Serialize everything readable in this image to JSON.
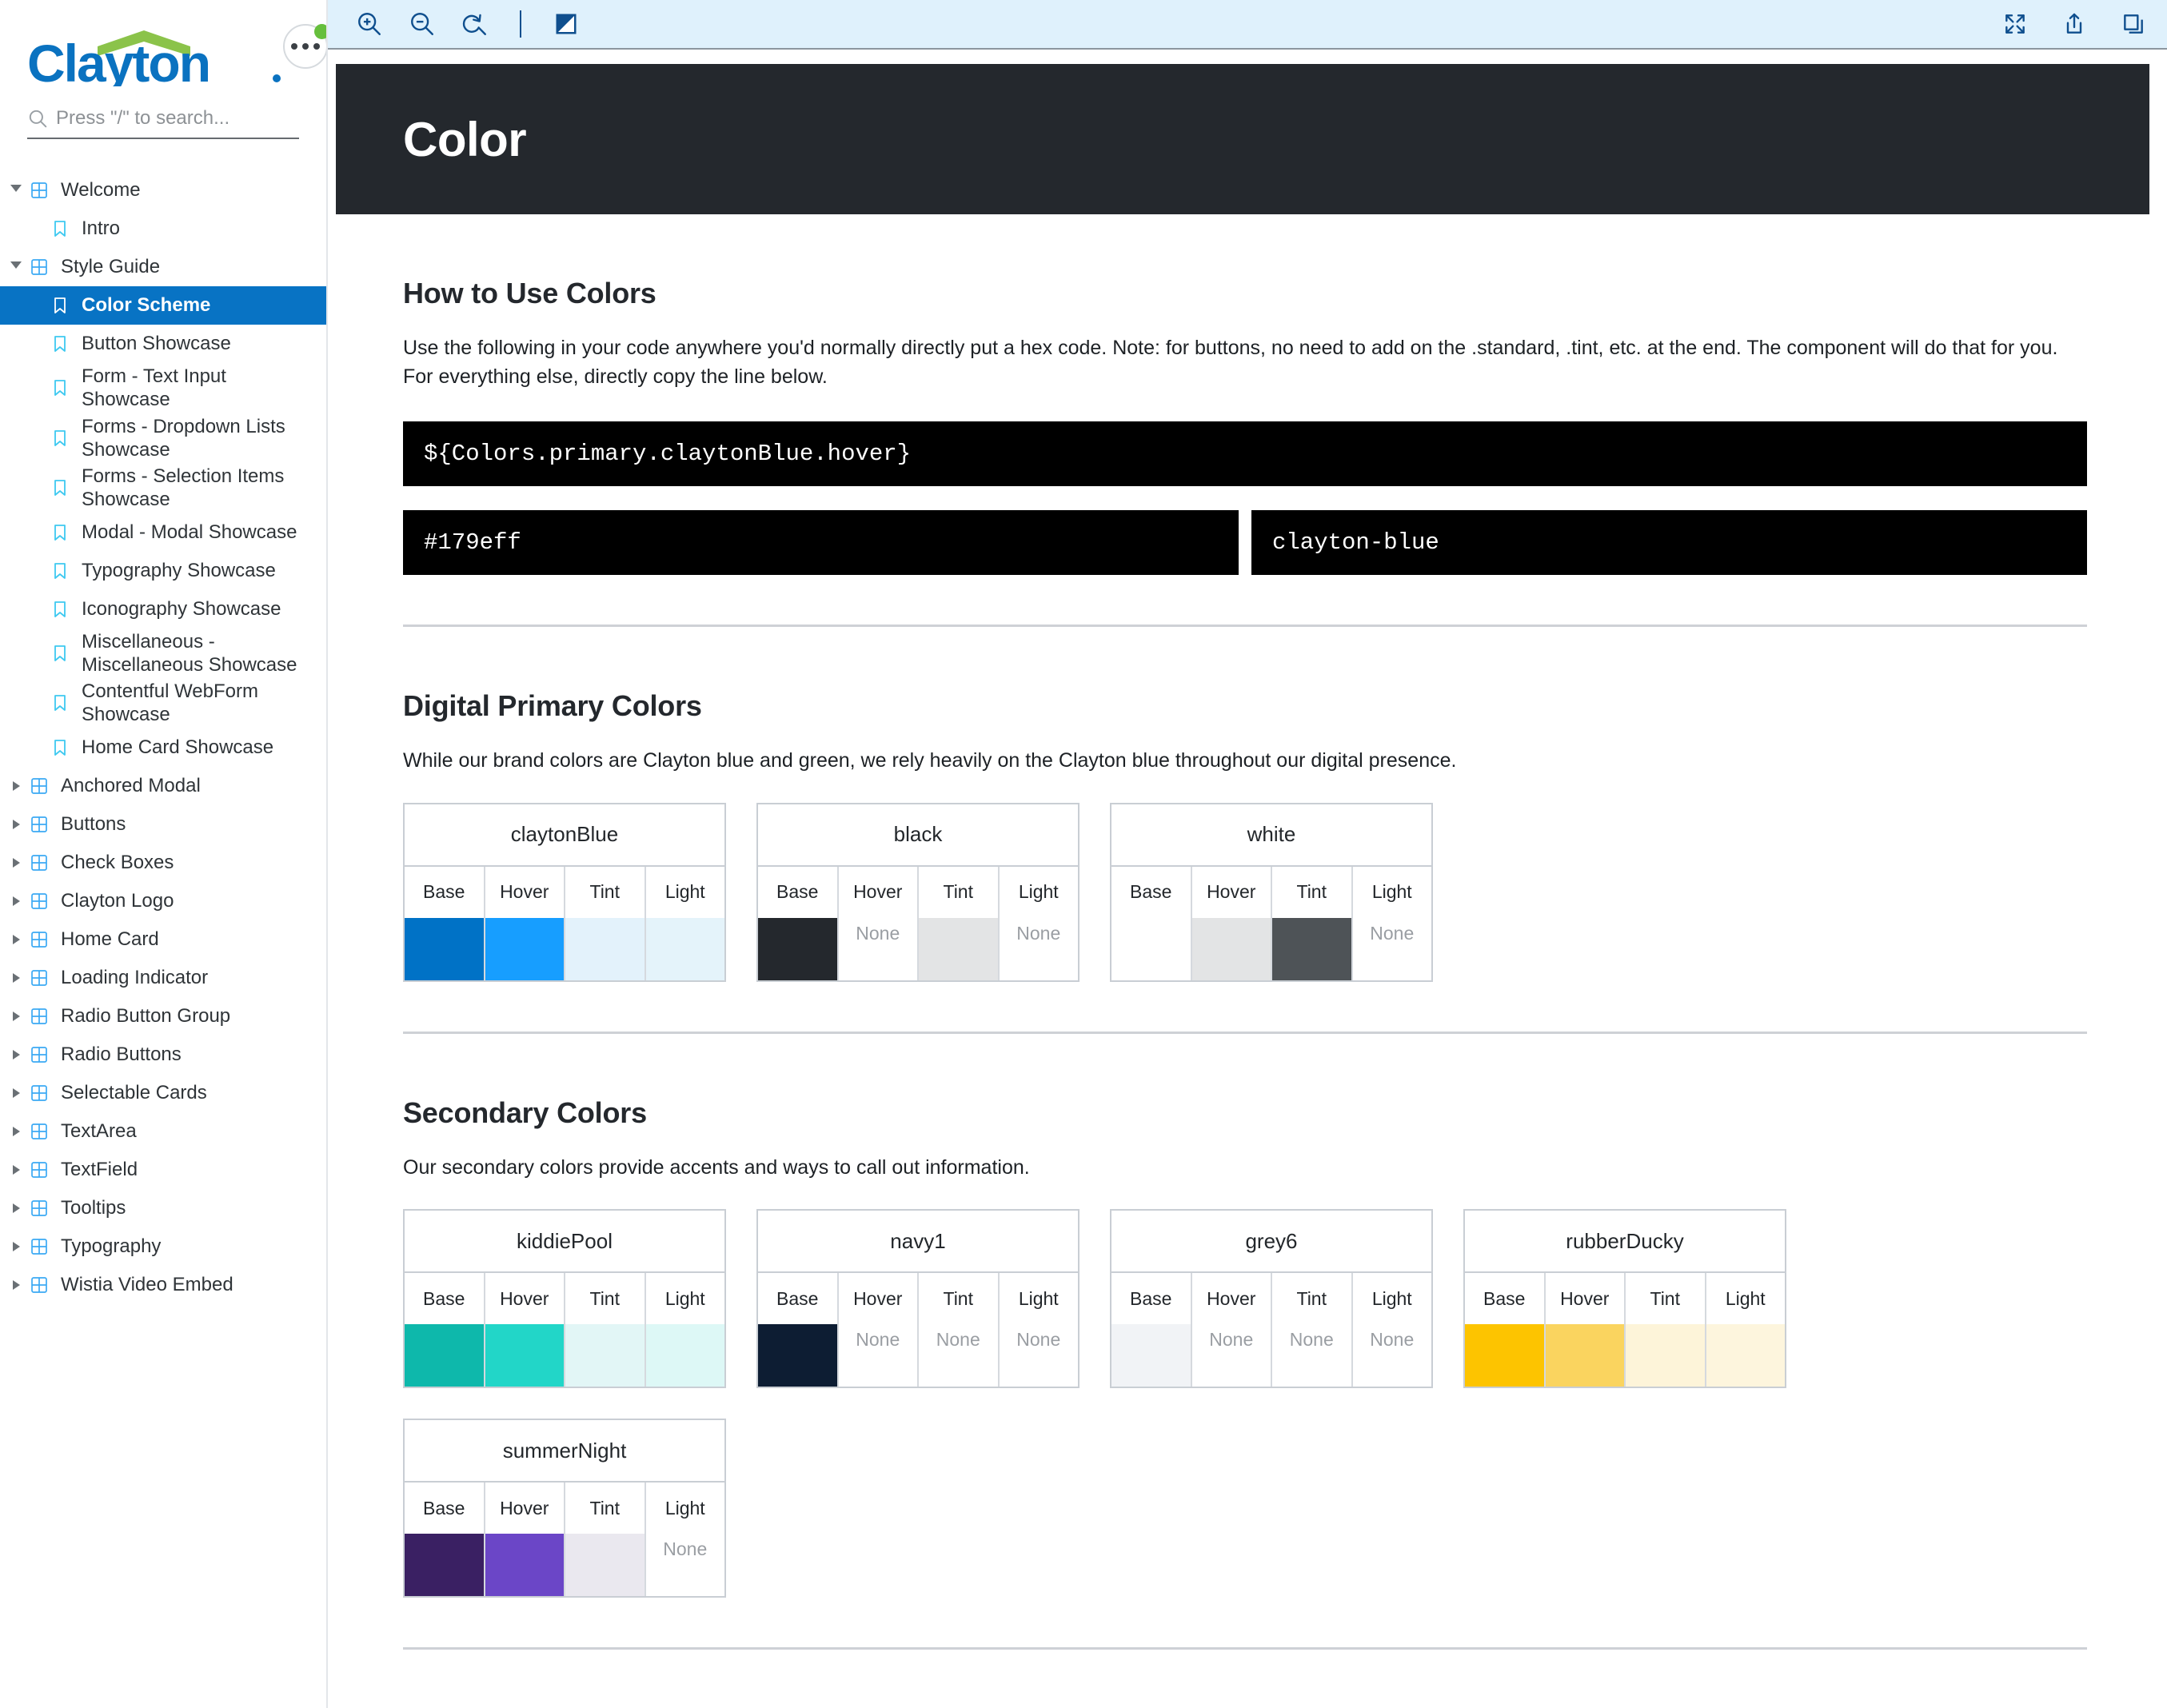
{
  "sidebar": {
    "brand": "Clayton",
    "search": {
      "placeholder": "Press \"/\" to search...",
      "value": ""
    },
    "items": [
      {
        "label": "Welcome",
        "level": "root",
        "icon": "component-icon",
        "caret": "open",
        "selected": false
      },
      {
        "label": "Intro",
        "level": "child",
        "icon": "bookmark-icon",
        "caret": "none",
        "selected": false
      },
      {
        "label": "Style Guide",
        "level": "root",
        "icon": "component-icon",
        "caret": "open",
        "selected": false
      },
      {
        "label": "Color Scheme",
        "level": "child",
        "icon": "bookmark-icon",
        "caret": "none",
        "selected": true
      },
      {
        "label": "Button Showcase",
        "level": "child",
        "icon": "bookmark-icon",
        "caret": "none",
        "selected": false
      },
      {
        "label": "Form - Text Input Showcase",
        "level": "child",
        "icon": "bookmark-icon",
        "caret": "none",
        "selected": false
      },
      {
        "label": "Forms - Dropdown Lists Showcase",
        "level": "child",
        "icon": "bookmark-icon",
        "caret": "none",
        "selected": false
      },
      {
        "label": "Forms - Selection Items Showcase",
        "level": "child",
        "icon": "bookmark-icon",
        "caret": "none",
        "selected": false
      },
      {
        "label": "Modal - Modal Showcase",
        "level": "child",
        "icon": "bookmark-icon",
        "caret": "none",
        "selected": false
      },
      {
        "label": "Typography Showcase",
        "level": "child",
        "icon": "bookmark-icon",
        "caret": "none",
        "selected": false
      },
      {
        "label": "Iconography Showcase",
        "level": "child",
        "icon": "bookmark-icon",
        "caret": "none",
        "selected": false
      },
      {
        "label": "Miscellaneous - Miscellaneous Showcase",
        "level": "child",
        "icon": "bookmark-icon",
        "caret": "none",
        "selected": false
      },
      {
        "label": "Contentful WebForm Showcase",
        "level": "child",
        "icon": "bookmark-icon",
        "caret": "none",
        "selected": false
      },
      {
        "label": "Home Card Showcase",
        "level": "child",
        "icon": "bookmark-icon",
        "caret": "none",
        "selected": false
      },
      {
        "label": "Anchored Modal",
        "level": "root",
        "icon": "component-icon",
        "caret": "closed",
        "selected": false
      },
      {
        "label": "Buttons",
        "level": "root",
        "icon": "component-icon",
        "caret": "closed",
        "selected": false
      },
      {
        "label": "Check Boxes",
        "level": "root",
        "icon": "component-icon",
        "caret": "closed",
        "selected": false
      },
      {
        "label": "Clayton Logo",
        "level": "root",
        "icon": "component-icon",
        "caret": "closed",
        "selected": false
      },
      {
        "label": "Home Card",
        "level": "root",
        "icon": "component-icon",
        "caret": "closed",
        "selected": false
      },
      {
        "label": "Loading Indicator",
        "level": "root",
        "icon": "component-icon",
        "caret": "closed",
        "selected": false
      },
      {
        "label": "Radio Button Group",
        "level": "root",
        "icon": "component-icon",
        "caret": "closed",
        "selected": false
      },
      {
        "label": "Radio Buttons",
        "level": "root",
        "icon": "component-icon",
        "caret": "closed",
        "selected": false
      },
      {
        "label": "Selectable Cards",
        "level": "root",
        "icon": "component-icon",
        "caret": "closed",
        "selected": false
      },
      {
        "label": "TextArea",
        "level": "root",
        "icon": "component-icon",
        "caret": "closed",
        "selected": false
      },
      {
        "label": "TextField",
        "level": "root",
        "icon": "component-icon",
        "caret": "closed",
        "selected": false
      },
      {
        "label": "Tooltips",
        "level": "root",
        "icon": "component-icon",
        "caret": "closed",
        "selected": false
      },
      {
        "label": "Typography",
        "level": "root",
        "icon": "component-icon",
        "caret": "closed",
        "selected": false
      },
      {
        "label": "Wistia Video Embed",
        "level": "root",
        "icon": "component-icon",
        "caret": "closed",
        "selected": false
      }
    ]
  },
  "toolbar": {
    "left": [
      {
        "name": "zoom-in-icon",
        "title": "Zoom in"
      },
      {
        "name": "zoom-out-icon",
        "title": "Zoom out"
      },
      {
        "name": "zoom-reset-icon",
        "title": "Reset zoom"
      },
      {
        "name": "contrast-icon",
        "title": "Change background"
      }
    ],
    "right": [
      {
        "name": "fullscreen-icon",
        "title": "Go full screen"
      },
      {
        "name": "share-icon",
        "title": "Open canvas in new tab"
      },
      {
        "name": "copy-icon",
        "title": "Copy canvas link"
      }
    ]
  },
  "page": {
    "title": "Color",
    "sections": [
      {
        "heading": "How to Use Colors",
        "body": "Use the following in your code anywhere you'd normally directly put a hex code. Note: for buttons, no need to add on the .standard, .tint, etc. at the end. The component will do that for you. For everything else, directly copy the line below."
      }
    ],
    "code_main": "${Colors.primary.claytonBlue.hover}",
    "code_hex": "#179eff",
    "code_token": "clayton-blue",
    "primary": {
      "heading": "Digital Primary Colors",
      "body": "While our brand colors are Clayton blue and green, we rely heavily on the Clayton blue throughout our digital presence."
    },
    "secondary": {
      "heading": "Secondary Colors",
      "body": "Our secondary colors provide accents and ways to call out information."
    },
    "column_headers": [
      "Base",
      "Hover",
      "Tint",
      "Light"
    ],
    "none_label": "None"
  },
  "swatch_groups": [
    {
      "id": "primary",
      "cards": [
        {
          "name": "claytonBlue",
          "cells": [
            {
              "label": "Base",
              "value": "#0072c6",
              "none": false
            },
            {
              "label": "Hover",
              "value": "#179eff",
              "none": false
            },
            {
              "label": "Tint",
              "value": "#e3f2fb",
              "none": false
            },
            {
              "label": "Light",
              "value": "#e4f3fa",
              "none": false
            }
          ]
        },
        {
          "name": "black",
          "cells": [
            {
              "label": "Base",
              "value": "#24282d",
              "none": false
            },
            {
              "label": "Hover",
              "value": "",
              "none": true
            },
            {
              "label": "Tint",
              "value": "#e3e4e5",
              "none": false
            },
            {
              "label": "Light",
              "value": "",
              "none": true
            }
          ]
        },
        {
          "name": "white",
          "cells": [
            {
              "label": "Base",
              "value": "#ffffff",
              "none": false
            },
            {
              "label": "Hover",
              "value": "#e3e4e5",
              "none": false
            },
            {
              "label": "Tint",
              "value": "#4e5357",
              "none": false
            },
            {
              "label": "Light",
              "value": "",
              "none": true
            }
          ]
        }
      ]
    },
    {
      "id": "secondary",
      "cards": [
        {
          "name": "kiddiePool",
          "cells": [
            {
              "label": "Base",
              "value": "#0eb8ab",
              "none": false
            },
            {
              "label": "Hover",
              "value": "#22d6c8",
              "none": false
            },
            {
              "label": "Tint",
              "value": "#e2f6f6",
              "none": false
            },
            {
              "label": "Light",
              "value": "#ddf8f6",
              "none": false
            }
          ]
        },
        {
          "name": "navy1",
          "cells": [
            {
              "label": "Base",
              "value": "#0d1d33",
              "none": false
            },
            {
              "label": "Hover",
              "value": "",
              "none": true
            },
            {
              "label": "Tint",
              "value": "",
              "none": true
            },
            {
              "label": "Light",
              "value": "",
              "none": true
            }
          ]
        },
        {
          "name": "grey6",
          "cells": [
            {
              "label": "Base",
              "value": "#f1f3f6",
              "none": false
            },
            {
              "label": "Hover",
              "value": "",
              "none": true
            },
            {
              "label": "Tint",
              "value": "",
              "none": true
            },
            {
              "label": "Light",
              "value": "",
              "none": true
            }
          ]
        },
        {
          "name": "rubberDucky",
          "cells": [
            {
              "label": "Base",
              "value": "#fdc400",
              "none": false
            },
            {
              "label": "Hover",
              "value": "#fad45f",
              "none": false
            },
            {
              "label": "Tint",
              "value": "#fdf4d9",
              "none": false
            },
            {
              "label": "Light",
              "value": "#fdf5dd",
              "none": false
            }
          ]
        },
        {
          "name": "summerNight",
          "cells": [
            {
              "label": "Base",
              "value": "#3a2063",
              "none": false
            },
            {
              "label": "Hover",
              "value": "#6b46c7",
              "none": false
            },
            {
              "label": "Tint",
              "value": "#eae8ef",
              "none": false
            },
            {
              "label": "Light",
              "value": "",
              "none": true
            }
          ]
        }
      ]
    }
  ],
  "colors": {
    "accent_blue": "#0873c4",
    "logo_blue": "#0a72c0",
    "logo_green": "#8bc34a",
    "toolbar_bg": "#dff1fc",
    "toolbar_icon": "#0f4f8e",
    "banner_bg": "#24282d",
    "status_green": "#66bf3c"
  }
}
